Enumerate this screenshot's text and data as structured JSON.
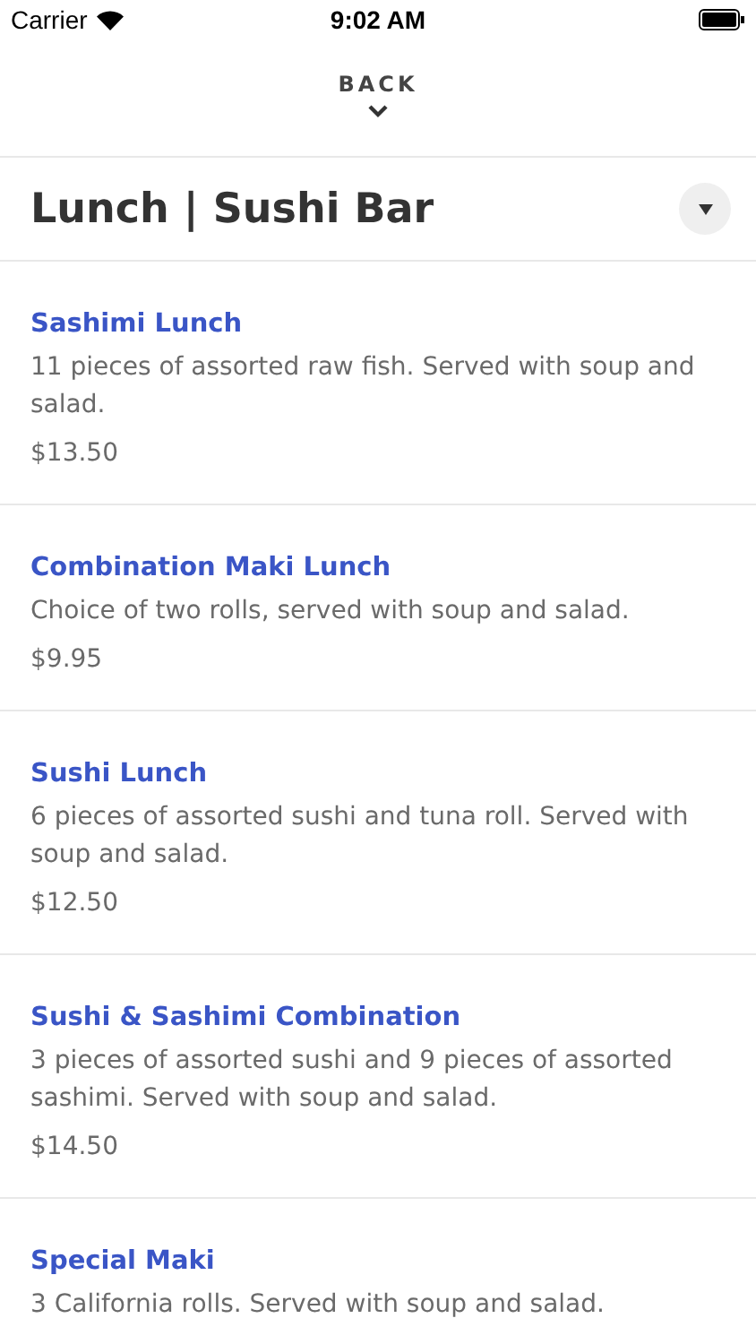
{
  "status_bar": {
    "carrier": "Carrier",
    "time": "9:02 AM"
  },
  "back": {
    "label": "BACK"
  },
  "header": {
    "title": "Lunch | Sushi Bar"
  },
  "items": [
    {
      "name": "Sashimi Lunch",
      "description": "11 pieces of assorted raw fish. Served with soup and salad.",
      "price": "$13.50"
    },
    {
      "name": "Combination Maki Lunch",
      "description": "Choice of two rolls, served with soup and salad.",
      "price": "$9.95"
    },
    {
      "name": "Sushi Lunch",
      "description": "6 pieces of assorted sushi and tuna roll. Served with soup and salad.",
      "price": "$12.50"
    },
    {
      "name": "Sushi & Sashimi Combination",
      "description": "3 pieces of assorted sushi and 9 pieces of assorted sashimi. Served with soup and salad.",
      "price": "$14.50"
    },
    {
      "name": "Special Maki",
      "description": "3 California rolls. Served with soup and salad."
    }
  ]
}
